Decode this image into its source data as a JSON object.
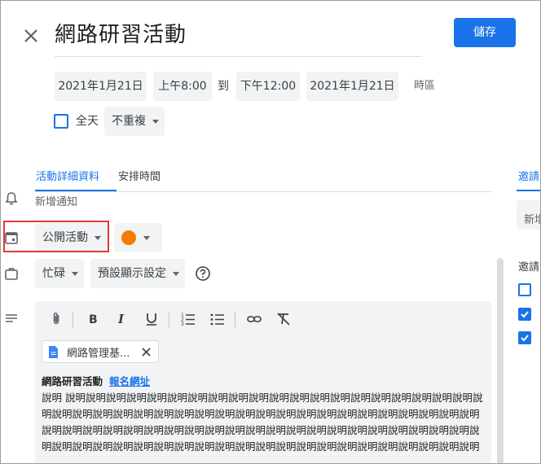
{
  "header": {
    "title": "網路研習活動",
    "save_label": "儲存"
  },
  "datetime": {
    "start_date": "2021年1月21日",
    "start_time": "上午8:00",
    "separator": "到",
    "end_time": "下午12:00",
    "end_date": "2021年1月21日",
    "timezone_label": "時區"
  },
  "options": {
    "all_day_label": "全天",
    "all_day_checked": false,
    "repeat_value": "不重複"
  },
  "tabs": [
    {
      "label": "活動詳細資料",
      "active": true
    },
    {
      "label": "安排時間",
      "active": false
    }
  ],
  "details": {
    "add_notification": "新增通知",
    "visibility_value": "公開活動",
    "event_color": "#f57c00",
    "availability_value": "忙碌",
    "default_visibility_value": "預設顯示設定"
  },
  "editor": {
    "attachment_name": "網路管理基...",
    "desc_title": "網路研習活動",
    "desc_link": "報名網址",
    "desc_body": "說明 說明說明說明說明說明說明說明說明說明說明說明說明說明說明說明說明說明說明說明說明說明說明說明說明說明說明說明說明說明說明說明說明說明說明說明說明說明說明說明說明說明說明說明說明說明說明說明說明說明說明說明說明說明說明說明說明說明說明說明說明說明說明說明說明說明說明說明說明說明說明說明說明說明說明說明說明說明說明說明說明說明說明說明說明說明"
  },
  "guests": {
    "tab_label": "邀請",
    "add_guest_placeholder": "新增",
    "permissions_label": "邀請",
    "checkboxes": [
      false,
      true,
      true
    ]
  },
  "colors": {
    "accent": "#1a73e8",
    "highlight_border": "#e53935"
  }
}
